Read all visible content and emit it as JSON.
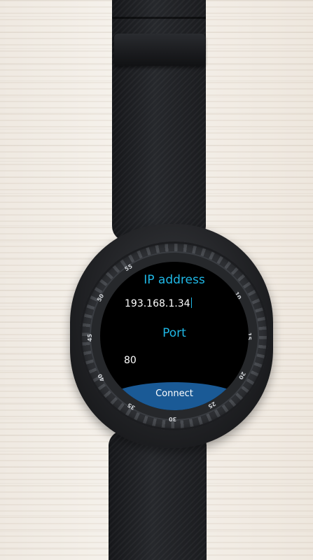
{
  "bezel": {
    "labels": [
      "55",
      "10",
      "15",
      "20",
      "25",
      "30",
      "35",
      "40",
      "45",
      "50"
    ]
  },
  "screen": {
    "ip_title": "IP address",
    "ip_value": "193.168.1.34",
    "port_title": "Port",
    "port_value": "80",
    "connect_label": "Connect"
  },
  "colors": {
    "accent": "#1fb8e6",
    "button": "#1a5a96",
    "screen_bg": "#000000"
  }
}
